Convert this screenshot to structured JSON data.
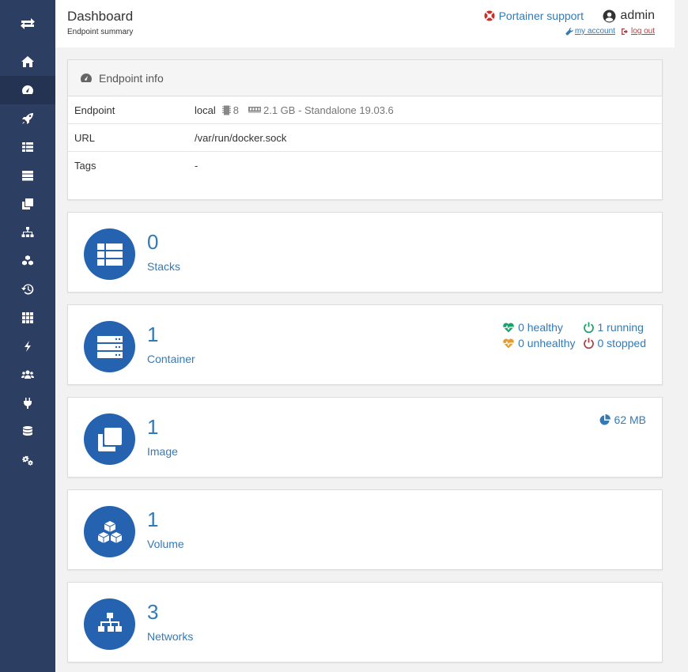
{
  "header": {
    "title": "Dashboard",
    "subtitle": "Endpoint summary",
    "support_label": "Portainer support",
    "user_name": "admin",
    "my_account": "my account",
    "log_out": "log out"
  },
  "endpoint_info": {
    "title": "Endpoint info",
    "rows": [
      {
        "key": "Endpoint",
        "name": "local",
        "cpu": "8",
        "memory": "2.1 GB - Standalone 19.03.6"
      },
      {
        "key": "URL",
        "value": "/var/run/docker.sock"
      },
      {
        "key": "Tags",
        "value": "-"
      }
    ]
  },
  "widgets": {
    "stacks": {
      "count": "0",
      "label": "Stacks"
    },
    "containers": {
      "count": "1",
      "label": "Container",
      "healthy": "0 healthy",
      "unhealthy": "0 unhealthy",
      "running": "1 running",
      "stopped": "0 stopped"
    },
    "images": {
      "count": "1",
      "label": "Image",
      "size": "62 MB"
    },
    "volumes": {
      "count": "1",
      "label": "Volume"
    },
    "networks": {
      "count": "3",
      "label": "Networks"
    }
  },
  "colors": {
    "sidebar": "#2d3e63",
    "accent": "#337ab7",
    "circle": "#2563b0",
    "healthy": "#1aa36e",
    "unhealthy": "#e69d2b",
    "stopped": "#a94442"
  },
  "sidebar_icons": [
    "home-icon",
    "tachometer-icon",
    "rocket-icon",
    "list-icon",
    "server-icon",
    "clone-icon",
    "sitemap-icon",
    "cubes-icon",
    "history-icon",
    "th-icon",
    "bolt-icon",
    "users-icon",
    "plug-icon",
    "database-icon",
    "cogs-icon"
  ]
}
